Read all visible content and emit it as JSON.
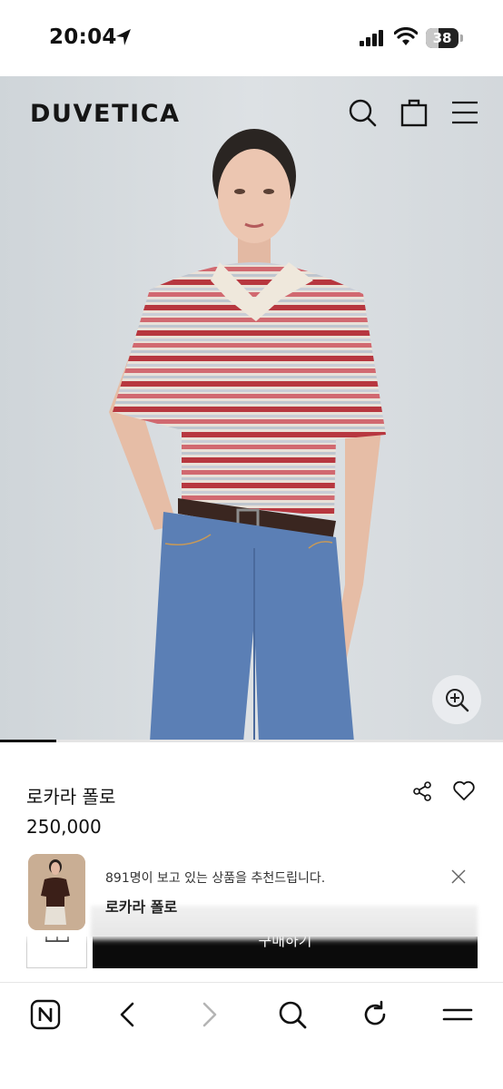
{
  "status_bar": {
    "time": "20:04",
    "battery_level": "38",
    "battery_fraction": 0.38,
    "icons": [
      "location-arrow-icon",
      "signal-icon",
      "wifi-icon",
      "battery-icon"
    ]
  },
  "header": {
    "brand": "DUVETICA",
    "icons": [
      "search-icon",
      "shopping-bag-icon",
      "menu-icon"
    ]
  },
  "hero": {
    "carousel_position": 1,
    "zoom_icon": "zoom-in-icon"
  },
  "product": {
    "name": "로카라 폴로",
    "price": "250,000",
    "icons": [
      "share-icon",
      "heart-icon"
    ]
  },
  "recommendation": {
    "message": "891명이 보고 있는 상품을 추천드립니다.",
    "product_name": "로카라 폴로",
    "close_icon": "close-icon"
  },
  "actions": {
    "buy_label": "구매하기",
    "wishlist_icon": "gift-icon"
  },
  "browser_toolbar": {
    "icons": [
      "naver-home-icon",
      "back-icon",
      "forward-icon",
      "search-icon",
      "reload-icon",
      "menu-icon"
    ]
  },
  "colors": {
    "hero_background": "#d6dbdf",
    "buy_button": "#0b0b0b",
    "text": "#111111"
  }
}
